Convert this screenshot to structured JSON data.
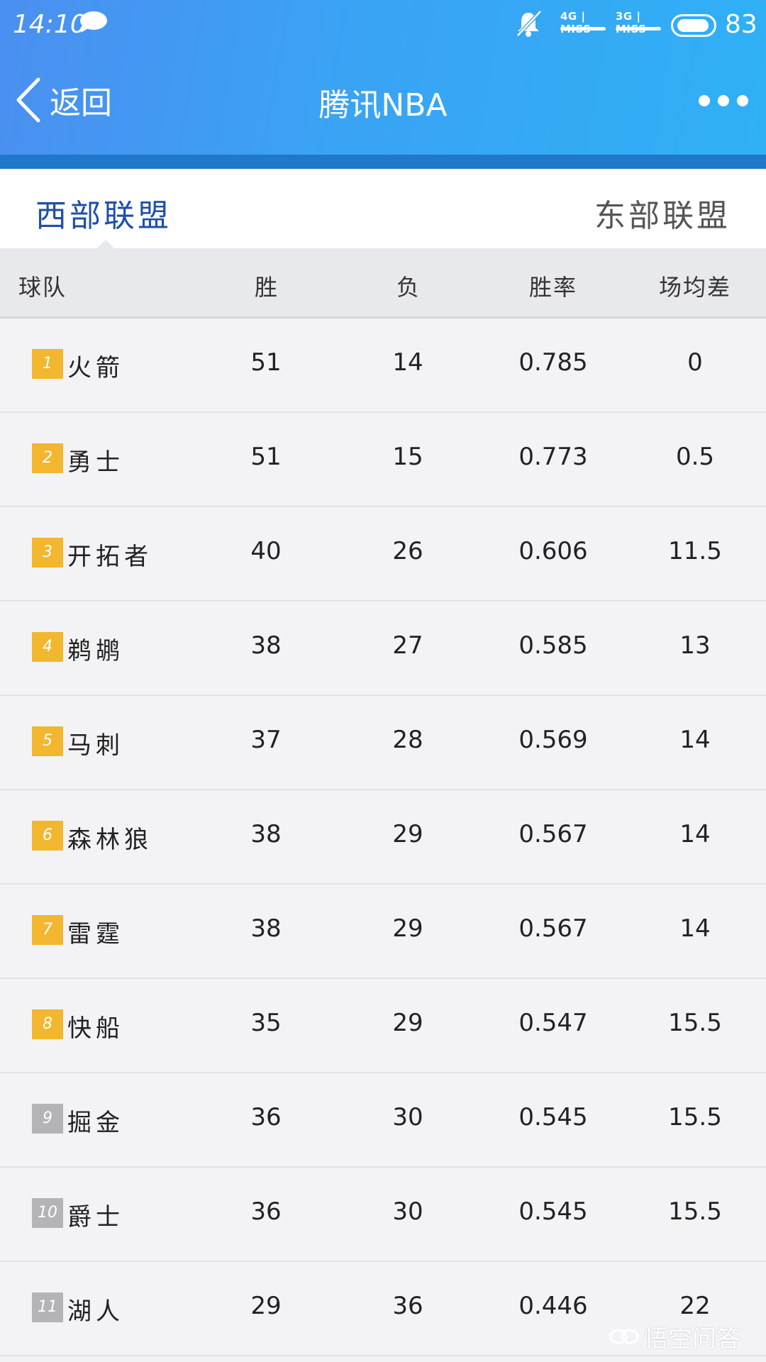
{
  "status_bar": {
    "time": "14:10",
    "network_1": "4G | MISS",
    "network_2": "3G | MISS",
    "battery": "83"
  },
  "nav": {
    "back_label": "返回",
    "title": "腾讯NBA"
  },
  "tabs": {
    "west": "西部联盟",
    "east": "东部联盟"
  },
  "table": {
    "headers": {
      "team": "球队",
      "wins": "胜",
      "losses": "负",
      "pct": "胜率",
      "gb": "场均差"
    },
    "rows": [
      {
        "rank": "1",
        "team": "火箭",
        "w": "51",
        "l": "14",
        "pct": "0.785",
        "gb": "0",
        "playoff": true
      },
      {
        "rank": "2",
        "team": "勇士",
        "w": "51",
        "l": "15",
        "pct": "0.773",
        "gb": "0.5",
        "playoff": true
      },
      {
        "rank": "3",
        "team": "开拓者",
        "w": "40",
        "l": "26",
        "pct": "0.606",
        "gb": "11.5",
        "playoff": true
      },
      {
        "rank": "4",
        "team": "鹈鹕",
        "w": "38",
        "l": "27",
        "pct": "0.585",
        "gb": "13",
        "playoff": true
      },
      {
        "rank": "5",
        "team": "马刺",
        "w": "37",
        "l": "28",
        "pct": "0.569",
        "gb": "14",
        "playoff": true
      },
      {
        "rank": "6",
        "team": "森林狼",
        "w": "38",
        "l": "29",
        "pct": "0.567",
        "gb": "14",
        "playoff": true
      },
      {
        "rank": "7",
        "team": "雷霆",
        "w": "38",
        "l": "29",
        "pct": "0.567",
        "gb": "14",
        "playoff": true
      },
      {
        "rank": "8",
        "team": "快船",
        "w": "35",
        "l": "29",
        "pct": "0.547",
        "gb": "15.5",
        "playoff": true
      },
      {
        "rank": "9",
        "team": "掘金",
        "w": "36",
        "l": "30",
        "pct": "0.545",
        "gb": "15.5",
        "playoff": false
      },
      {
        "rank": "10",
        "team": "爵士",
        "w": "36",
        "l": "30",
        "pct": "0.545",
        "gb": "15.5",
        "playoff": false
      },
      {
        "rank": "11",
        "team": "湖人",
        "w": "29",
        "l": "36",
        "pct": "0.446",
        "gb": "22",
        "playoff": false
      }
    ]
  },
  "watermark": {
    "text": "悟空问答"
  },
  "colors": {
    "header_start": "#4b8ff0",
    "header_end": "#2fb0f6",
    "active_tab": "#1f4fa8",
    "playoff_badge": "#f2b72f",
    "non_playoff_badge": "#b4b4b6"
  },
  "icons": [
    "chat-bubble-icon",
    "bell-muted-icon",
    "battery-icon",
    "back-chevron-icon",
    "more-dots-icon",
    "wukong-logo-icon"
  ]
}
